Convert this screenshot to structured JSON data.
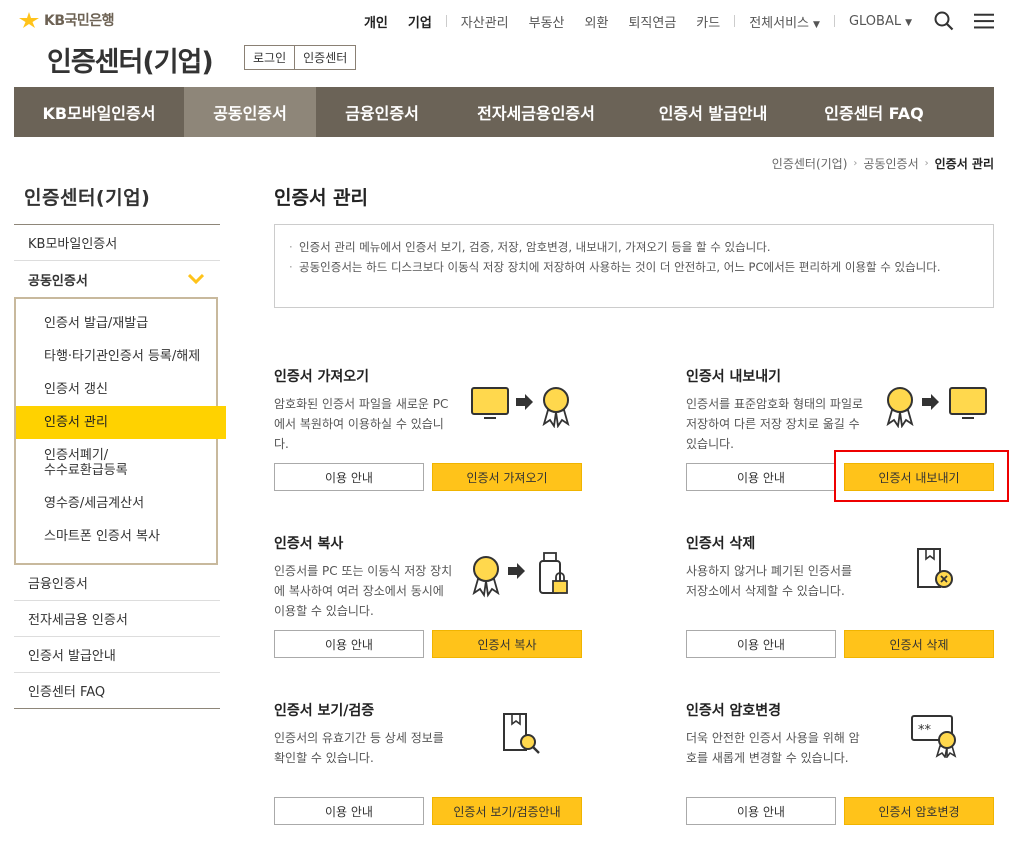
{
  "brand": {
    "name": "KB국민은행"
  },
  "topnav": {
    "items": [
      "개인",
      "기업",
      "자산관리",
      "부동산",
      "외환",
      "퇴직연금",
      "카드",
      "전체서비스",
      "GLOBAL"
    ]
  },
  "page": {
    "title": "인증센터(기업)",
    "tabs": [
      "로그인",
      "인증센터"
    ]
  },
  "gnb": [
    "KB모바일인증서",
    "공동인증서",
    "금융인증서",
    "전자세금용인증서",
    "인증서 발급안내",
    "인증센터 FAQ"
  ],
  "breadcrumb": [
    "인증센터(기업)",
    "공동인증서",
    "인증서 관리"
  ],
  "lnb": {
    "title": "인증센터(기업)",
    "items": [
      "KB모바일인증서",
      "공동인증서",
      "금융인증서",
      "전자세금용 인증서",
      "인증서 발급안내",
      "인증센터 FAQ"
    ],
    "sub": [
      "인증서 발급/재발급",
      "타행·타기관인증서 등록/해제",
      "인증서 갱신",
      "인증서 관리",
      "인증서폐기/\n수수료환급등록",
      "영수증/세금계산서",
      "스마트폰 인증서 복사"
    ]
  },
  "content": {
    "title": "인증서 관리",
    "notices": [
      "인증서 관리 메뉴에서 인증서 보기, 검증, 저장, 암호변경, 내보내기, 가져오기 등을 할 수 있습니다.",
      "공동인증서는 하드 디스크보다 이동식 저장 장치에 저장하여 사용하는 것이 더 안전하고, 어느 PC에서든 편리하게 이용할 수 있습니다."
    ],
    "cards": [
      {
        "title": "인증서 가져오기",
        "desc": "암호화된 인증서 파일을 새로운 PC에서 복원하여 이용하실 수 있습니다.",
        "guide": "이용 안내",
        "action": "인증서 가져오기"
      },
      {
        "title": "인증서 내보내기",
        "desc": "인증서를 표준암호화 형태의 파일로 저장하여 다른 저장 장치로 옮길 수 있습니다.",
        "guide": "이용 안내",
        "action": "인증서 내보내기"
      },
      {
        "title": "인증서 복사",
        "desc": "인증서를 PC 또는 이동식 저장 장치에 복사하여 여러 장소에서 동시에 이용할 수 있습니다.",
        "guide": "이용 안내",
        "action": "인증서 복사"
      },
      {
        "title": "인증서 삭제",
        "desc": "사용하지 않거나 폐기된 인증서를 저장소에서 삭제할 수 있습니다.",
        "guide": "이용 안내",
        "action": "인증서 삭제"
      },
      {
        "title": "인증서 보기/검증",
        "desc": "인증서의 유효기간 등 상세 정보를 확인할 수 있습니다.",
        "guide": "이용 안내",
        "action": "인증서 보기/검증안내"
      },
      {
        "title": "인증서 암호변경",
        "desc": "더욱 안전한 인증서 사용을 위해 암호를 새롭게 변경할 수 있습니다.",
        "guide": "이용 안내",
        "action": "인증서 암호변경"
      }
    ]
  },
  "colors": {
    "brand_gray": "#6b6357",
    "accent_yellow": "#ffc31a",
    "highlight_red": "#e00000"
  }
}
